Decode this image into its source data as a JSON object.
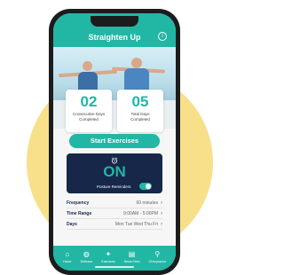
{
  "header": {
    "title": "Straighten Up",
    "info_icon": "i"
  },
  "stats": [
    {
      "value": "02",
      "label": "Consecutive Days Completed"
    },
    {
      "value": "05",
      "label": "Total Days Completed"
    }
  ],
  "start_button": {
    "label": "Start Exercises"
  },
  "reminder": {
    "status": "ON",
    "label": "Posture Reminders",
    "enabled": true
  },
  "settings": [
    {
      "label": "Frequency",
      "value": "60 minutes"
    },
    {
      "label": "Time Range",
      "value": "9:00AM - 5:00PM"
    },
    {
      "label": "Days",
      "value": "Mon Tue Wed Thu Fri"
    }
  ],
  "tabs": [
    {
      "label": "Home",
      "icon": "home-icon"
    },
    {
      "label": "Reflexes",
      "icon": "reflexes-icon"
    },
    {
      "label": "Exercises",
      "icon": "exercises-icon"
    },
    {
      "label": "News Feed",
      "icon": "news-feed-icon"
    },
    {
      "label": "Chiropractor",
      "icon": "chiropractor-icon"
    }
  ],
  "colors": {
    "accent": "#21b7a4",
    "navy": "#16274a",
    "background_circle": "#f8e08a"
  }
}
